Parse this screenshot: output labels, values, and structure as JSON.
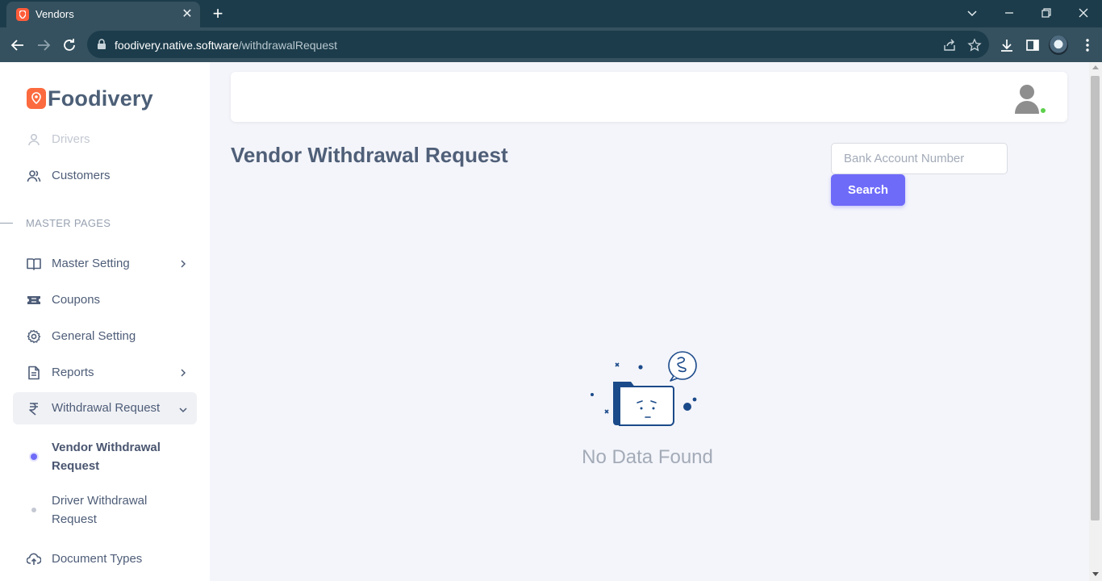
{
  "browser": {
    "tab_title": "Vendors",
    "url_host": "foodivery.native.software",
    "url_path": "/withdrawalRequest"
  },
  "sidebar": {
    "brand": "Foodivery",
    "items_top": [
      {
        "label": "Drivers",
        "icon": "user-icon"
      },
      {
        "label": "Customers",
        "icon": "users-icon"
      }
    ],
    "section_heading": "MASTER PAGES",
    "items": [
      {
        "label": "Master Setting",
        "icon": "book-open-icon"
      },
      {
        "label": "Coupons",
        "icon": "ticket-icon"
      },
      {
        "label": "General Setting",
        "icon": "gear-icon"
      },
      {
        "label": "Reports",
        "icon": "file-text-icon"
      },
      {
        "label": "Withdrawal Request",
        "icon": "rupee-icon"
      }
    ],
    "sub_items": [
      {
        "label": "Vendor Withdrawal Request"
      },
      {
        "label": "Driver Withdrawal Request"
      }
    ],
    "items_bottom": [
      {
        "label": "Document Types",
        "icon": "upload-cloud-icon"
      }
    ]
  },
  "main": {
    "title": "Vendor Withdrawal Request",
    "search_placeholder": "Bank Account Number",
    "search_value": "",
    "search_button": "Search",
    "empty_text": "No Data Found"
  },
  "colors": {
    "accent": "#6e6bf9",
    "brand": "#fc6a3f",
    "chrome_dark": "#1c3c4b",
    "chrome_mid": "#35515f",
    "online": "#5cd04b"
  }
}
